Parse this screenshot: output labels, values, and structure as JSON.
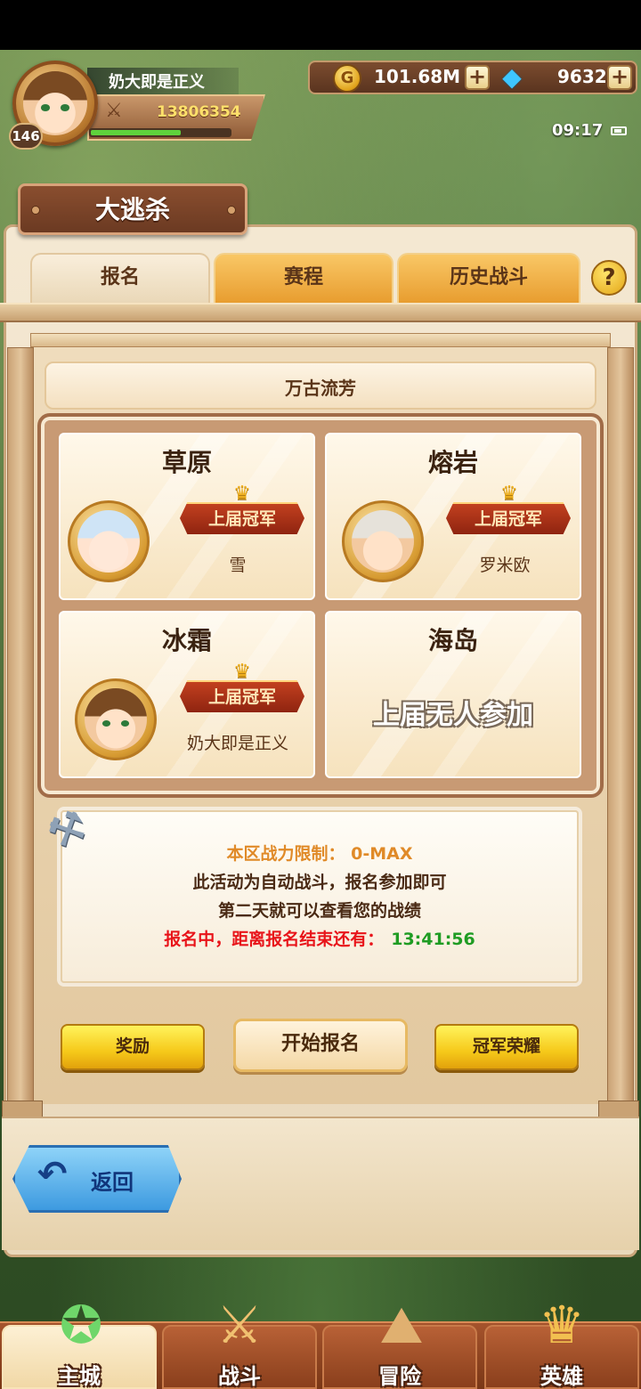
{
  "player": {
    "name": "奶大即是正义",
    "level": "146",
    "power": "13806354",
    "exp_fraction": 0.65
  },
  "currency": {
    "gold": "101.68M",
    "gold_icon": "gold-coin-icon",
    "gems": "9632",
    "gem_icon": "diamond-icon",
    "plus_label": "+"
  },
  "status": {
    "time": "09:17"
  },
  "page": {
    "title": "大逃杀",
    "tabs": [
      "报名",
      "赛程",
      "历史战斗"
    ],
    "help_label": "?",
    "subtitle": "万古流芳"
  },
  "arenas": [
    {
      "name": "草原",
      "badge": "上届冠军",
      "champion": "雪"
    },
    {
      "name": "熔岩",
      "badge": "上届冠军",
      "champion": "罗米欧"
    },
    {
      "name": "冰霜",
      "badge": "上届冠军",
      "champion": "奶大即是正义"
    },
    {
      "name": "海岛",
      "empty_text": "上届无人参加"
    }
  ],
  "info": {
    "limit_line": "本区战力限制： 0-MAX",
    "auto_line": "此活动为自动战斗，报名参加即可",
    "next_line": "第二天就可以查看您的战绩",
    "countdown_label": "报名中，距离报名结束还有：",
    "countdown_time": "13:41:56"
  },
  "buttons": {
    "reward": "奖励",
    "start": "开始报名",
    "honor": "冠军荣耀",
    "back": "返回"
  },
  "nav": [
    "主城",
    "战斗",
    "冒险",
    "英雄"
  ],
  "colors": {
    "countdown_label": "#e8141a",
    "countdown_time": "#1f9c23",
    "limit_text": "#e08a28",
    "exp_fill": "#5fd23c"
  }
}
